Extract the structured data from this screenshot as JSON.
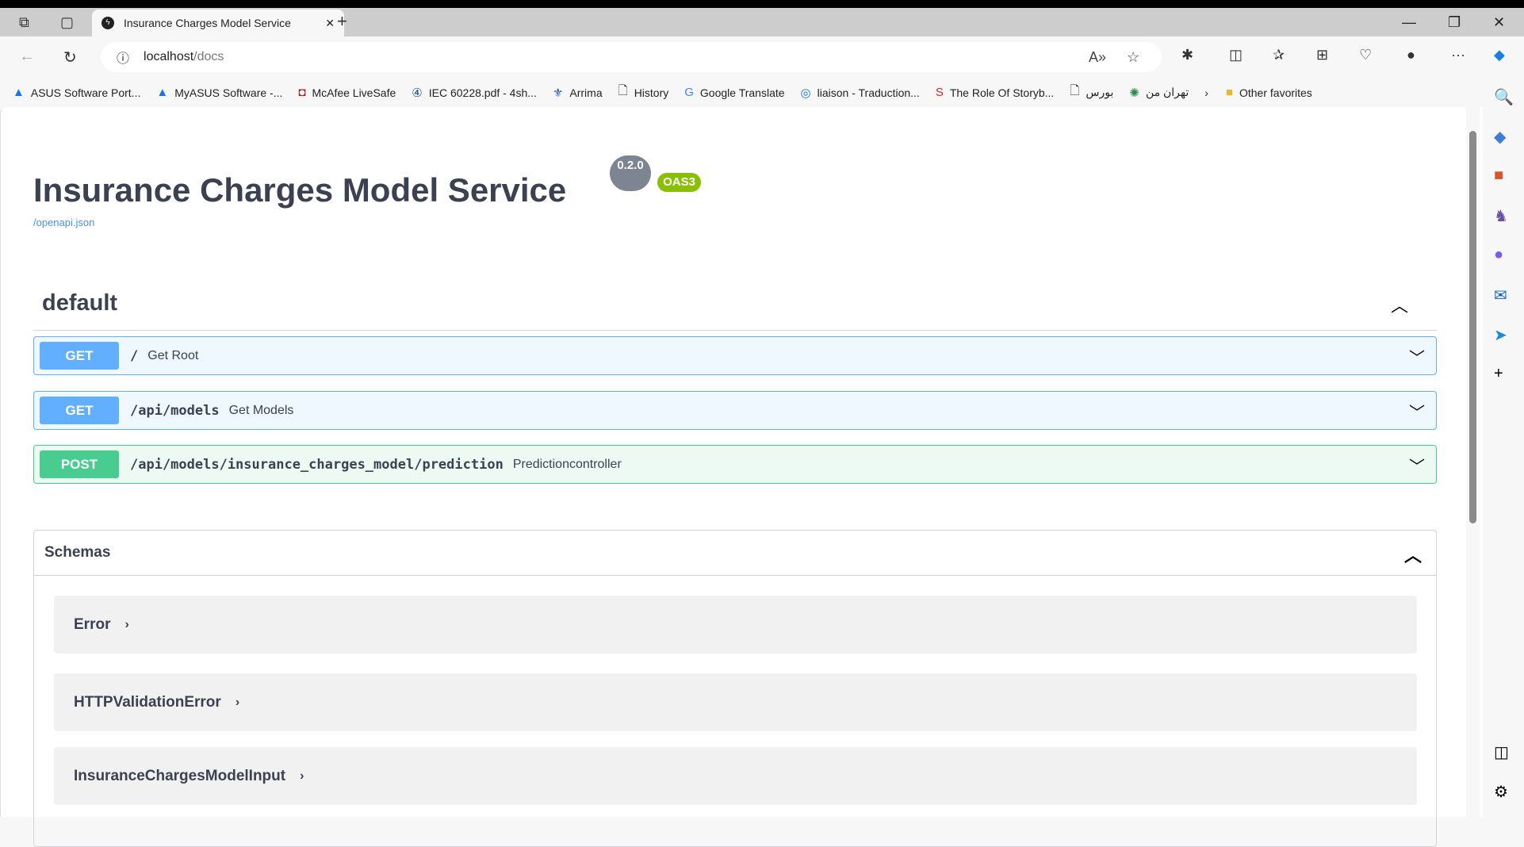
{
  "browser": {
    "tab_title": "Insurance Charges Model Service",
    "url_host": "localhost",
    "url_path": "/docs",
    "bookmarks": [
      {
        "label": "ASUS Software Port...",
        "icon": "asus-icon"
      },
      {
        "label": "MyASUS Software -...",
        "icon": "asus-icon"
      },
      {
        "label": "McAfee LiveSafe",
        "icon": "mcafee-icon"
      },
      {
        "label": "IEC 60228.pdf - 4sh...",
        "icon": "4shared-icon"
      },
      {
        "label": "Arrima",
        "icon": "quebec-icon"
      },
      {
        "label": "History",
        "icon": "page-icon"
      },
      {
        "label": "Google Translate",
        "icon": "translate-icon"
      },
      {
        "label": "liaison - Traduction...",
        "icon": "reverso-icon"
      },
      {
        "label": "The Role Of Storyb...",
        "icon": "s-icon"
      },
      {
        "label": "بورس",
        "icon": "page-icon"
      },
      {
        "label": "تهران من",
        "icon": "tehran-icon"
      }
    ],
    "other_favorites": "Other favorites"
  },
  "api": {
    "title": "Insurance Charges Model Service",
    "version": "0.2.0",
    "oas": "OAS3",
    "spec_link": "/openapi.json",
    "tag": "default",
    "operations": [
      {
        "method": "GET",
        "path": "/",
        "summary": "Get Root"
      },
      {
        "method": "GET",
        "path": "/api/models",
        "summary": "Get Models"
      },
      {
        "method": "POST",
        "path": "/api/models/insurance_charges_model/prediction",
        "summary": "Predictioncontroller"
      }
    ],
    "schemas_title": "Schemas",
    "schemas": [
      "Error",
      "HTTPValidationError",
      "InsuranceChargesModelInput"
    ]
  },
  "colors": {
    "get": "#61affe",
    "post": "#49cc90",
    "oas": "#89bf04"
  }
}
